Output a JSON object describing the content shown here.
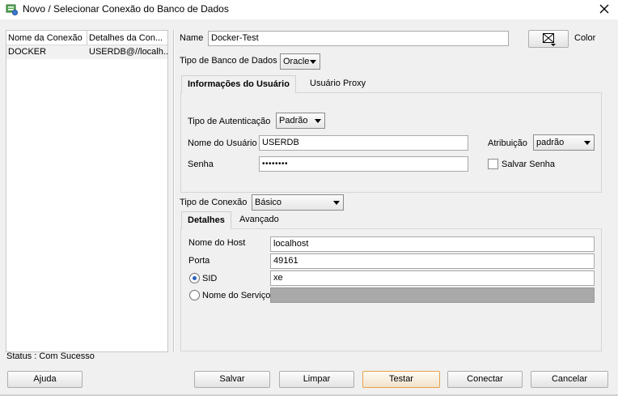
{
  "window": {
    "title": "Novo / Selecionar Conexão do Banco de Dados"
  },
  "connection_list": {
    "columns": [
      "Nome da Conexão",
      "Detalhes da Con..."
    ],
    "rows": [
      {
        "name": "DOCKER",
        "details": "USERDB@//localh..."
      }
    ]
  },
  "form": {
    "name_label": "Name",
    "name_value": "Docker-Test",
    "color_label": "Color",
    "db_type_label": "Tipo de Banco de Dados",
    "db_type_value": "Oracle"
  },
  "user_tabs": {
    "tab1": "Informações do Usuário",
    "tab2": "Usuário Proxy"
  },
  "user_info": {
    "auth_type_label": "Tipo de Autenticação",
    "auth_type_value": "Padrão",
    "username_label": "Nome do Usuário",
    "username_value": "USERDB",
    "role_label": "Atribuição",
    "role_value": "padrão",
    "password_label": "Senha",
    "password_value": "••••••••",
    "save_password_label": "Salvar Senha"
  },
  "connection": {
    "type_label": "Tipo de Conexão",
    "type_value": "Básico"
  },
  "details_tabs": {
    "tab1": "Detalhes",
    "tab2": "Avançado"
  },
  "details": {
    "host_label": "Nome do Host",
    "host_value": "localhost",
    "port_label": "Porta",
    "port_value": "49161",
    "sid_label": "SID",
    "sid_value": "xe",
    "service_label": "Nome do Serviço",
    "service_value": ""
  },
  "status": {
    "text": "Status : Com Sucesso"
  },
  "buttons": {
    "help": "Ajuda",
    "save": "Salvar",
    "clear": "Limpar",
    "test": "Testar",
    "connect": "Conectar",
    "cancel": "Cancelar"
  },
  "colors": {
    "focus_border": "#e8a04a",
    "radio_selected": "#2a5fb8",
    "window_bg": "#f0f0f0"
  },
  "icons": {
    "app": "database-plug-icon",
    "close": "close-icon",
    "color": "color-picker-icon"
  }
}
